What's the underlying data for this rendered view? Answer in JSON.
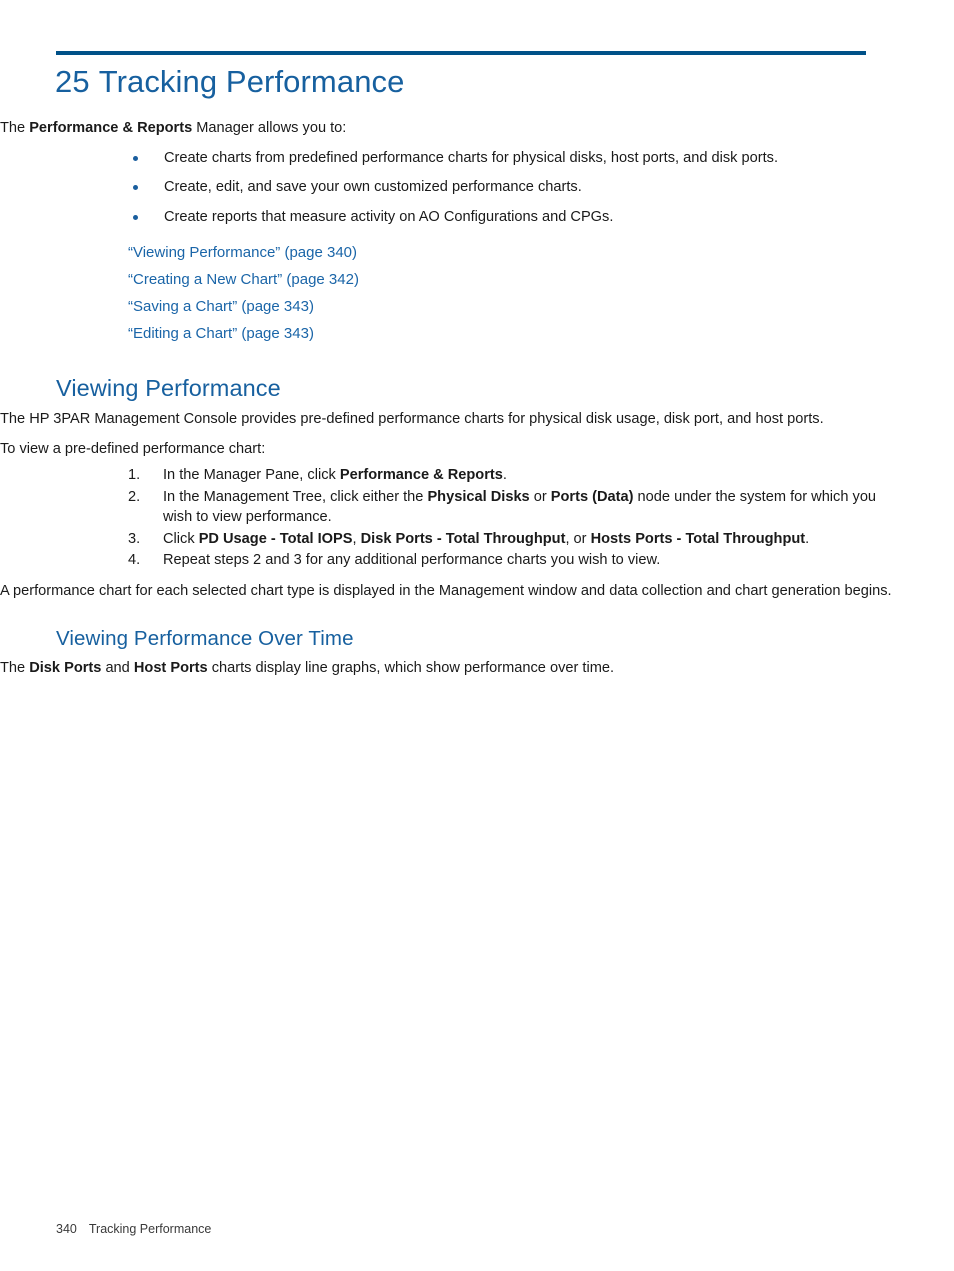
{
  "document": {
    "chapter_number": "25",
    "chapter_title": "Tracking Performance"
  },
  "intro": {
    "lead_prefix": "The ",
    "lead_bold": "Performance & Reports",
    "lead_suffix": " Manager allows you to:"
  },
  "bullets": [
    "Create charts from predefined performance charts for physical disks, host ports, and disk ports.",
    "Create, edit, and save your own customized performance charts.",
    "Create reports that measure activity on AO Configurations and CPGs."
  ],
  "cross_references": [
    "“Viewing Performance” (page 340)",
    "“Creating a New Chart” (page 342)",
    "“Saving a Chart” (page 343)",
    "“Editing a Chart” (page 343)"
  ],
  "section_viewing_performance": {
    "heading": "Viewing Performance",
    "para1": "The HP 3PAR Management Console provides pre-defined performance charts for physical disk usage, disk port, and host ports.",
    "para2": "To view a pre-defined performance chart:",
    "steps": [
      {
        "marker": "1.",
        "p1": "In the Manager Pane, click ",
        "b1": "Performance & Reports",
        "p2": ".",
        "b2": "",
        "p3": "",
        "b3": "",
        "p4": ""
      },
      {
        "marker": "2.",
        "p1": "In the Management Tree, click either the ",
        "b1": "Physical Disks",
        "p2": " or ",
        "b2": "Ports (Data)",
        "p3": " node under the system for which you wish to view performance.",
        "b3": "",
        "p4": ""
      },
      {
        "marker": "3.",
        "p1": "Click ",
        "b1": "PD Usage - Total IOPS",
        "p2": ", ",
        "b2": "Disk Ports - Total Throughput",
        "p3": ", or ",
        "b3": "Hosts Ports - Total Throughput",
        "p4": "."
      },
      {
        "marker": "4.",
        "p1": "Repeat steps 2 and 3 for any additional performance charts you wish to view.",
        "b1": "",
        "p2": "",
        "b2": "",
        "p3": "",
        "b3": "",
        "p4": ""
      }
    ],
    "para3": "A performance chart for each selected chart type is displayed in the Management window and data collection and chart generation begins."
  },
  "section_over_time": {
    "heading": "Viewing Performance Over Time",
    "para_prefix": "The ",
    "para_bold1": "Disk Ports",
    "para_mid": " and ",
    "para_bold2": "Host Ports",
    "para_suffix": " charts display line graphs, which show performance over time."
  },
  "footer": {
    "page_number": "340",
    "chapter_name": "Tracking Performance"
  },
  "colors": {
    "rule": "#005188",
    "heading_blue": "#17609f",
    "link_blue": "#1a65a8",
    "body_text": "#1a1a1a"
  }
}
